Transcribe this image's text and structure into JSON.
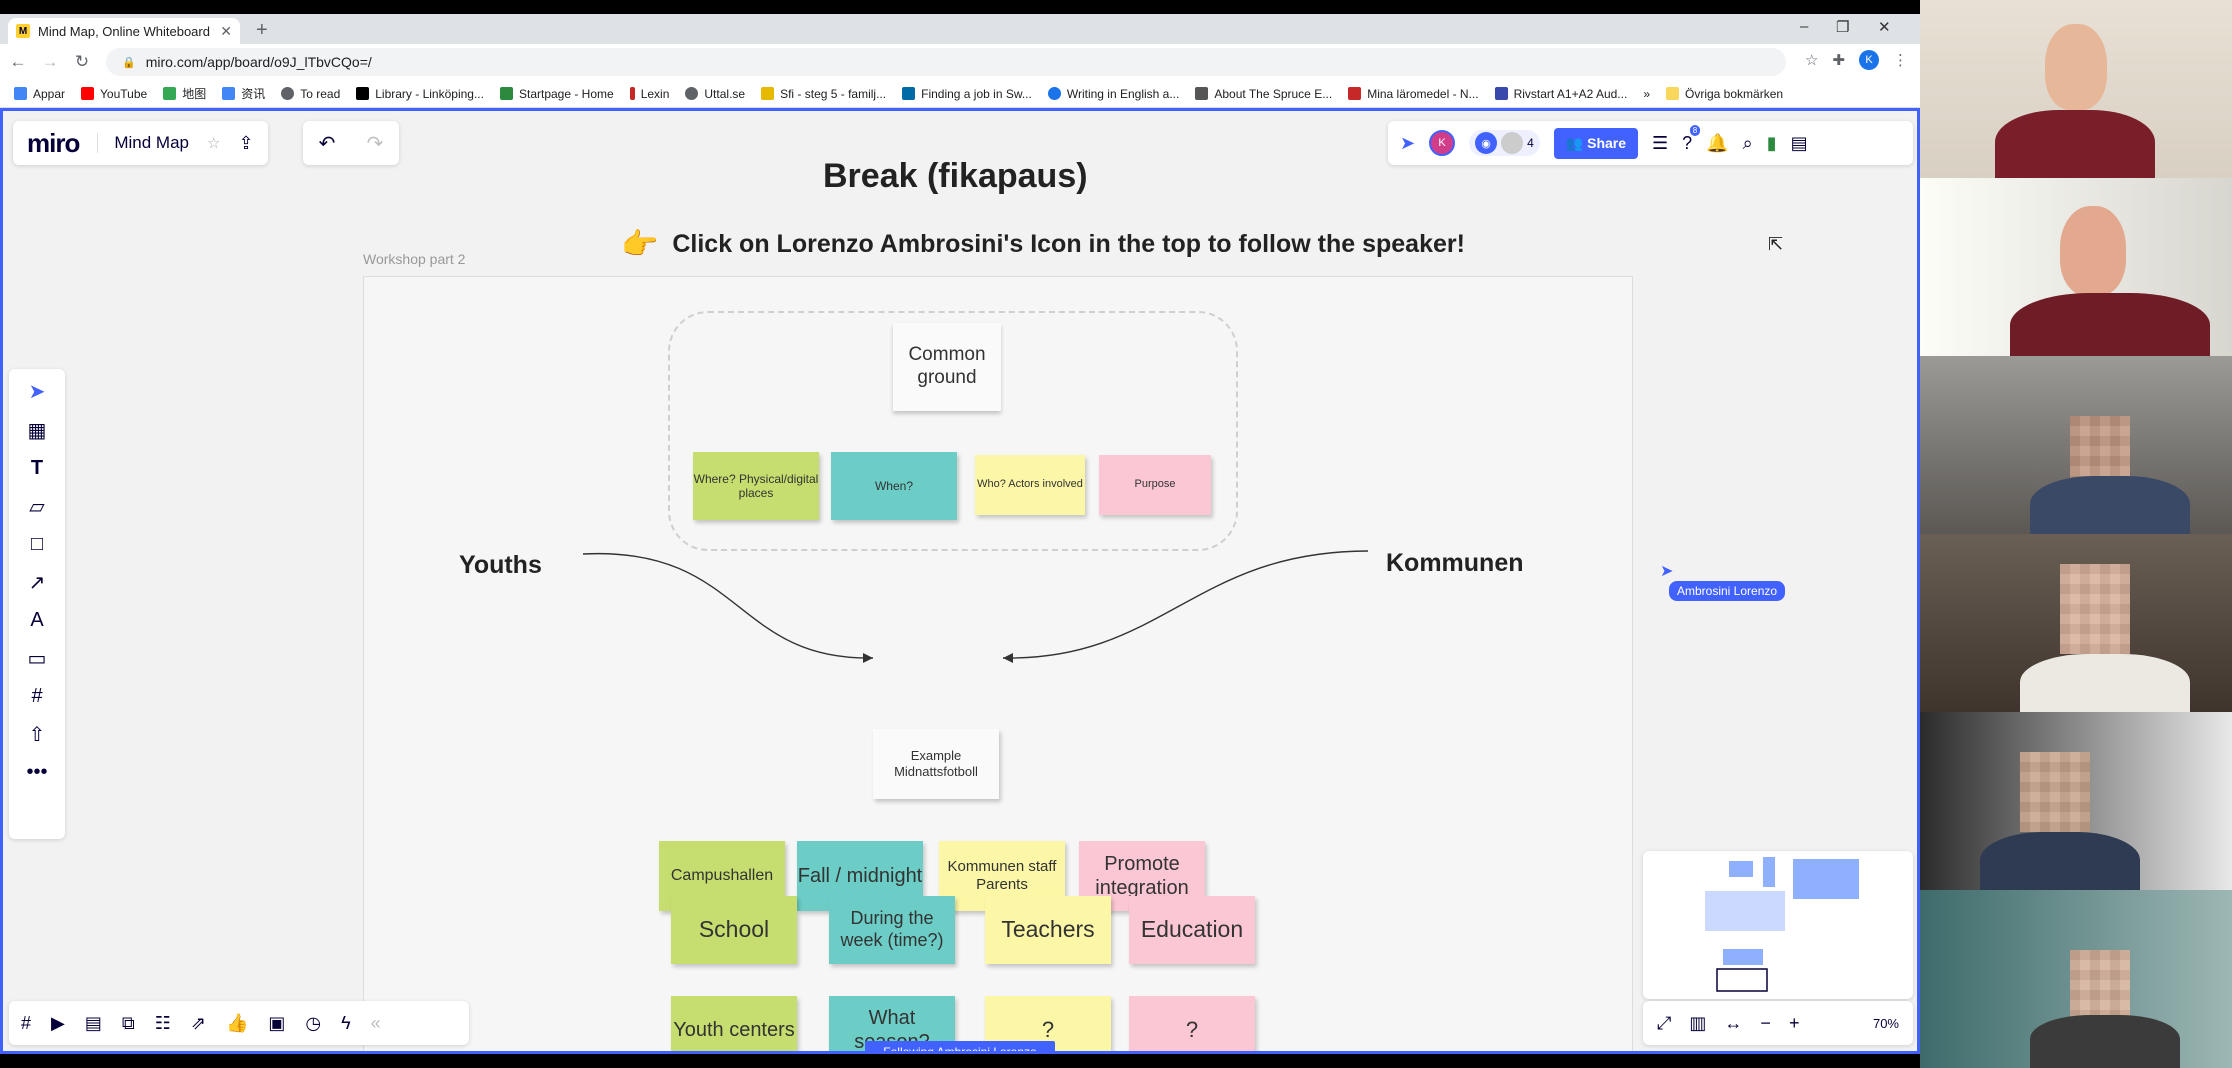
{
  "browser": {
    "tab_title": "Mind Map, Online Whiteboard fo",
    "tab_favicon": "miro-icon",
    "url": "miro.com/app/board/o9J_lTbvCQo=/",
    "account_initial": "K",
    "bookmarks": [
      {
        "label": "Appar",
        "color": "#4285f4"
      },
      {
        "label": "YouTube",
        "color": "#ff0000"
      },
      {
        "label": "地图",
        "color": "#34a853"
      },
      {
        "label": "资讯",
        "color": "#4285f4"
      },
      {
        "label": "To read",
        "color": "#5f6368"
      },
      {
        "label": "Library - Linköping...",
        "color": "#000000"
      },
      {
        "label": "Startpage - Home",
        "color": "#2b8a3e"
      },
      {
        "label": "Lexin",
        "color": "#c62828"
      },
      {
        "label": "Uttal.se",
        "color": "#5f6368"
      },
      {
        "label": "Sfi - steg 5 - familj...",
        "color": "#e6b800"
      },
      {
        "label": "Finding a job in Sw...",
        "color": "#006aa7"
      },
      {
        "label": "Writing in English a...",
        "color": "#1a73e8"
      },
      {
        "label": "About The Spruce E...",
        "color": "#555555"
      },
      {
        "label": "Mina läromedel - N...",
        "color": "#c62828"
      },
      {
        "label": "Rivstart A1+A2 Aud...",
        "color": "#3949ab"
      }
    ],
    "bookmarks_more": "»",
    "other_bookmarks": "Övriga bokmärken"
  },
  "miro": {
    "logo": "miro",
    "board_name": "Mind Map",
    "share_label": "Share",
    "viewer_count": "4",
    "collab_initial": "K",
    "notif_badge": "8",
    "frame_label": "Workshop part 2",
    "break_title": "Break (fikapaus)",
    "click_note": "Click on Lorenzo Ambrosini's Icon in the top to follow the speaker!",
    "cursor_name": "Ambrosini Lorenzo",
    "follow_banner": "Following Ambrosini Lorenzo",
    "zoom": "70%",
    "common_ground": "Common ground",
    "youths": "Youths",
    "kommunen": "Kommunen",
    "example": "Example Midnattsfotboll",
    "row1": [
      {
        "text": "Where? Physical/digital places",
        "color": "#c6de6f"
      },
      {
        "text": "When?",
        "color": "#6ccdc7"
      },
      {
        "text": "Who? Actors involved",
        "color": "#fbf7a6"
      },
      {
        "text": "Purpose",
        "color": "#fbc7d4"
      }
    ],
    "row2": [
      {
        "text": "Campushallen",
        "color": "#c6de6f"
      },
      {
        "text": "Fall / midnight",
        "color": "#6ccdc7"
      },
      {
        "text": "Kommunen staff Parents",
        "color": "#fbf7a6"
      },
      {
        "text": "Promote integration",
        "color": "#fbc7d4"
      }
    ],
    "row3": [
      {
        "text": "School",
        "color": "#c6de6f"
      },
      {
        "text": "During the week (time?)",
        "color": "#6ccdc7"
      },
      {
        "text": "Teachers",
        "color": "#fbf7a6"
      },
      {
        "text": "Education",
        "color": "#fbc7d4"
      }
    ],
    "row4": [
      {
        "text": "Youth centers",
        "color": "#c6de6f"
      },
      {
        "text": "What season?",
        "color": "#6ccdc7"
      },
      {
        "text": "?",
        "color": "#fbf7a6"
      },
      {
        "text": "?",
        "color": "#fbc7d4"
      }
    ]
  }
}
